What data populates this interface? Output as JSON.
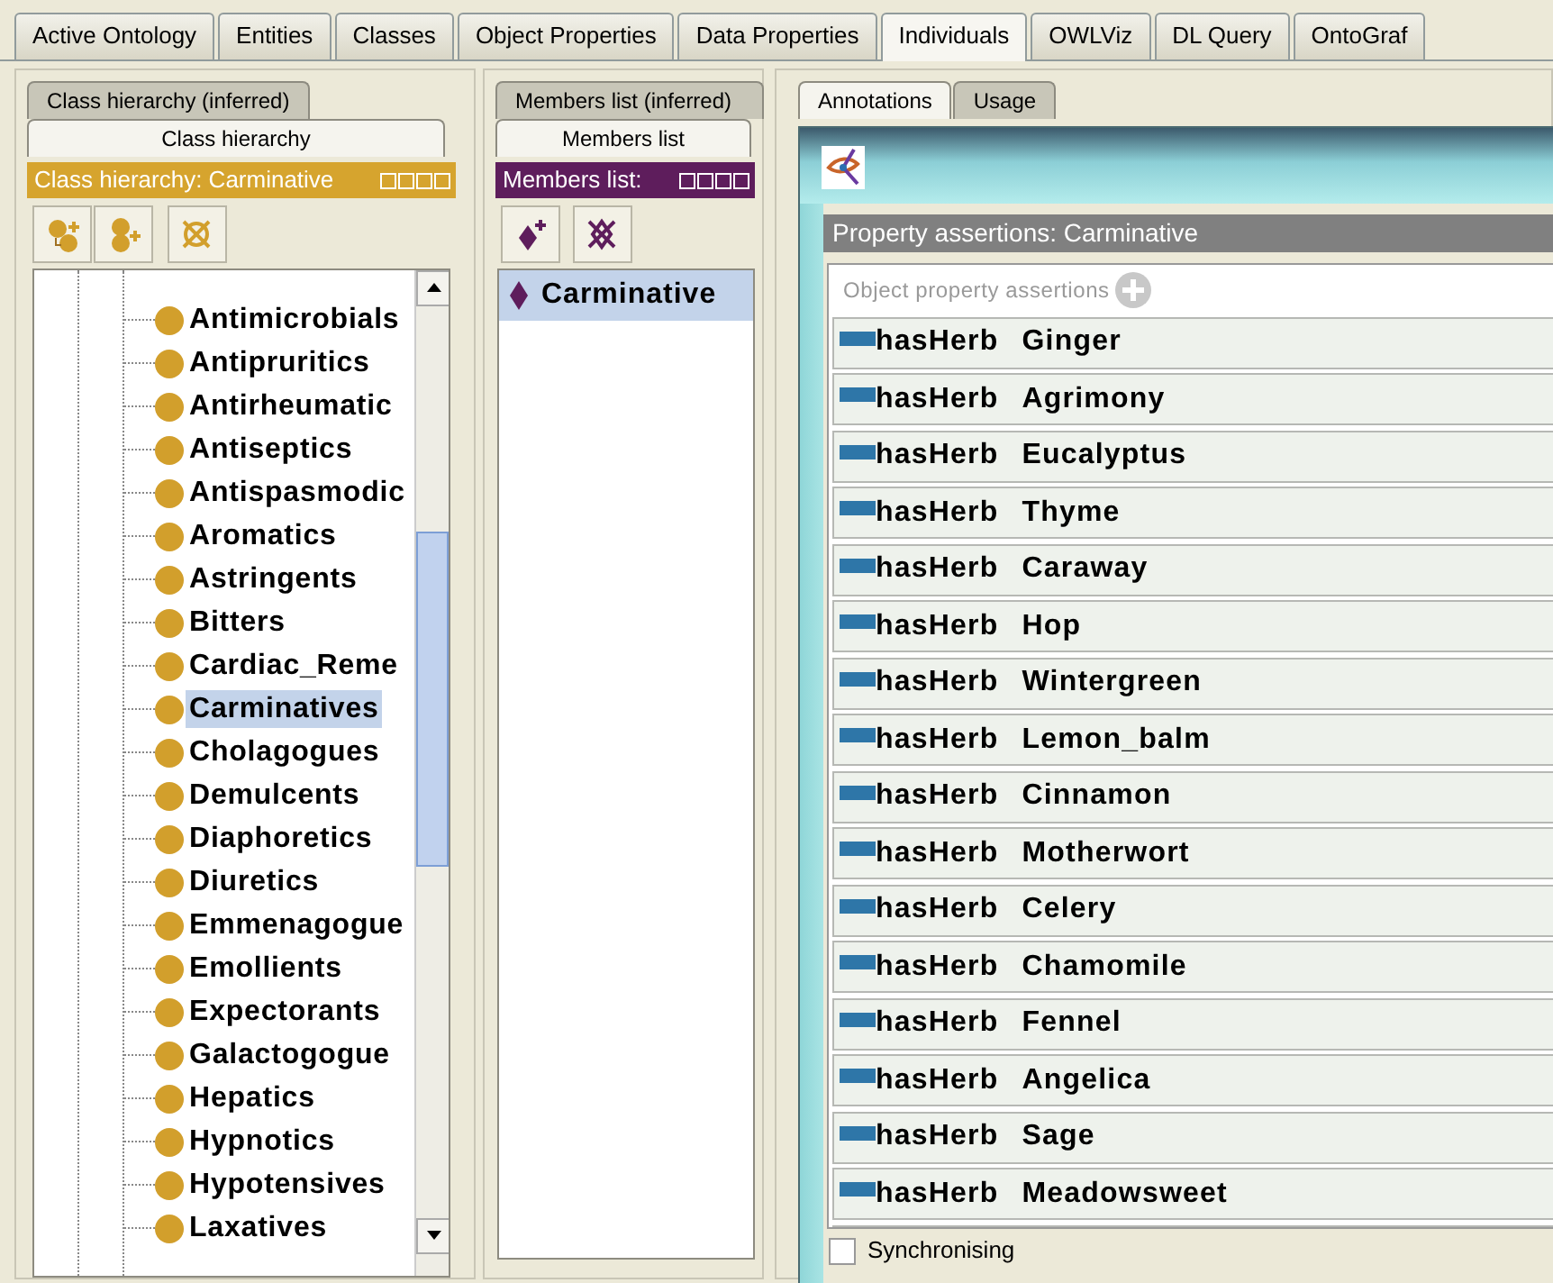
{
  "tabs": [
    {
      "label": "Active Ontology",
      "selected": false
    },
    {
      "label": "Entities",
      "selected": false
    },
    {
      "label": "Classes",
      "selected": false
    },
    {
      "label": "Object Properties",
      "selected": false
    },
    {
      "label": "Data Properties",
      "selected": false
    },
    {
      "label": "Individuals",
      "selected": true
    },
    {
      "label": "OWLViz",
      "selected": false
    },
    {
      "label": "DL Query",
      "selected": false
    },
    {
      "label": "OntoGraf",
      "selected": false
    }
  ],
  "class_panel": {
    "tabs": [
      {
        "label": "Class hierarchy (inferred)",
        "selected": false
      },
      {
        "label": "Class hierarchy",
        "selected": true
      }
    ],
    "header": "Class hierarchy: Carminative",
    "tree": [
      {
        "label": "Antimicrobials",
        "selected": false
      },
      {
        "label": "Antipruritics",
        "selected": false
      },
      {
        "label": "Antirheumatic",
        "selected": false
      },
      {
        "label": "Antiseptics",
        "selected": false
      },
      {
        "label": "Antispasmodic",
        "selected": false
      },
      {
        "label": "Aromatics",
        "selected": false
      },
      {
        "label": "Astringents",
        "selected": false
      },
      {
        "label": "Bitters",
        "selected": false
      },
      {
        "label": "Cardiac_Reme",
        "selected": false
      },
      {
        "label": "Carminatives",
        "selected": true
      },
      {
        "label": "Cholagogues",
        "selected": false
      },
      {
        "label": "Demulcents",
        "selected": false
      },
      {
        "label": "Diaphoretics",
        "selected": false
      },
      {
        "label": "Diuretics",
        "selected": false
      },
      {
        "label": "Emmenagogue",
        "selected": false
      },
      {
        "label": "Emollients",
        "selected": false
      },
      {
        "label": "Expectorants",
        "selected": false
      },
      {
        "label": "Galactogogue",
        "selected": false
      },
      {
        "label": "Hepatics",
        "selected": false
      },
      {
        "label": "Hypnotics",
        "selected": false
      },
      {
        "label": "Hypotensives",
        "selected": false
      },
      {
        "label": "Laxatives",
        "selected": false
      }
    ]
  },
  "members_panel": {
    "tabs": [
      {
        "label": "Members list (inferred)",
        "selected": false
      },
      {
        "label": "Members list",
        "selected": true
      }
    ],
    "header": "Members list:",
    "items": [
      {
        "label": "Carminative",
        "selected": true
      }
    ]
  },
  "individual_panel": {
    "tabs": [
      {
        "label": "Annotations",
        "selected": true
      },
      {
        "label": "Usage",
        "selected": false
      }
    ]
  },
  "dialog": {
    "section_title": "Property assertions: Carminative",
    "group_label": "Object property assertions",
    "assertions": [
      {
        "property": "hasHerb",
        "value": "Ginger"
      },
      {
        "property": "hasHerb",
        "value": "Agrimony"
      },
      {
        "property": "hasHerb",
        "value": "Eucalyptus"
      },
      {
        "property": "hasHerb",
        "value": "Thyme"
      },
      {
        "property": "hasHerb",
        "value": "Caraway"
      },
      {
        "property": "hasHerb",
        "value": "Hop"
      },
      {
        "property": "hasHerb",
        "value": "Wintergreen"
      },
      {
        "property": "hasHerb",
        "value": "Lemon_balm"
      },
      {
        "property": "hasHerb",
        "value": "Cinnamon"
      },
      {
        "property": "hasHerb",
        "value": "Motherwort"
      },
      {
        "property": "hasHerb",
        "value": "Celery"
      },
      {
        "property": "hasHerb",
        "value": "Chamomile"
      },
      {
        "property": "hasHerb",
        "value": "Fennel"
      },
      {
        "property": "hasHerb",
        "value": "Angelica"
      },
      {
        "property": "hasHerb",
        "value": "Sage"
      },
      {
        "property": "hasHerb",
        "value": "Meadowsweet"
      }
    ],
    "synchronising": {
      "label": "Synchronising",
      "checked": false
    }
  }
}
